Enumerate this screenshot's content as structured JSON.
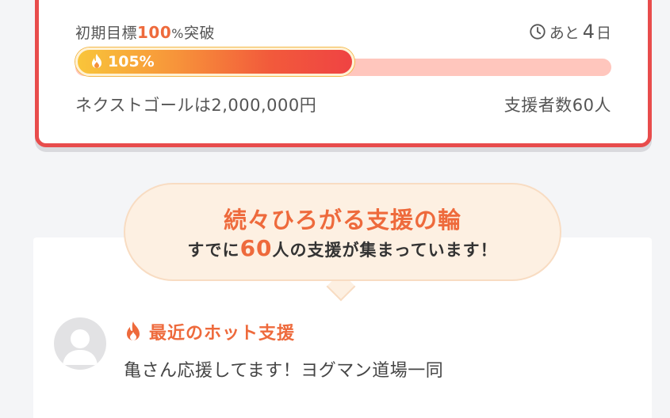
{
  "progress_card": {
    "goal_prefix": "初期目標",
    "goal_percent": "100",
    "goal_percent_sign": "%",
    "goal_suffix": "突破",
    "remaining_prefix": "あと",
    "remaining_days": "4",
    "remaining_unit": "日",
    "progress_label": "105%",
    "progress_fraction": 1.05,
    "next_goal": "ネクストゴールは2,000,000円",
    "supporters": "支援者数60人"
  },
  "bubble": {
    "title": "続々ひろがる支援の輪",
    "sub_prefix": "すでに",
    "sub_number": "60",
    "sub_suffix": "人の支援が集まっています！"
  },
  "hot_support": {
    "title": "最近のホット支援",
    "message": "亀さん応援してます！ヨグマン道場一同"
  },
  "colors": {
    "accent": "#ee6a3c",
    "card_border": "#e84c4c",
    "bar_track": "#ffc6bd",
    "bubble_bg": "#fdf0e2"
  }
}
